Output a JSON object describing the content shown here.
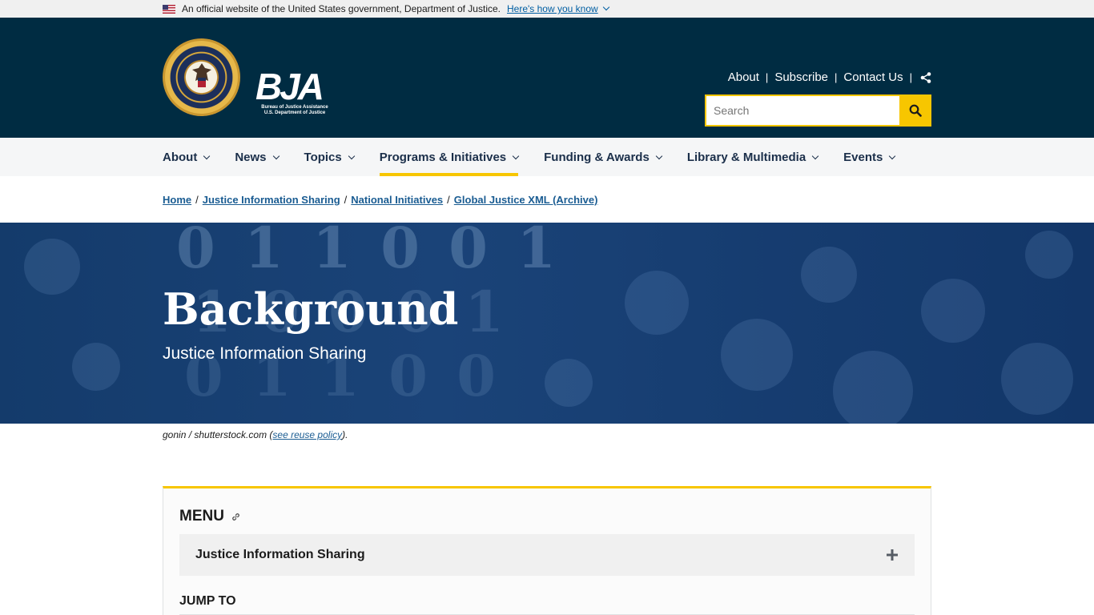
{
  "gov_banner": {
    "text": "An official website of the United States government, Department of Justice.",
    "link": "Here's how you know"
  },
  "header": {
    "logo_letters": "BJA",
    "logo_sub_1": "Bureau of Justice Assistance",
    "logo_sub_2": "U.S. Department of Justice",
    "utility_nav": [
      "About",
      "Subscribe",
      "Contact Us"
    ],
    "search_placeholder": "Search"
  },
  "main_nav": {
    "items": [
      {
        "label": "About",
        "active": false
      },
      {
        "label": "News",
        "active": false
      },
      {
        "label": "Topics",
        "active": false
      },
      {
        "label": "Programs & Initiatives",
        "active": true
      },
      {
        "label": "Funding & Awards",
        "active": false
      },
      {
        "label": "Library & Multimedia",
        "active": false
      },
      {
        "label": "Events",
        "active": false
      }
    ]
  },
  "breadcrumb": [
    "Home",
    "Justice Information Sharing",
    "National Initiatives",
    "Global Justice XML (Archive)"
  ],
  "hero": {
    "title": "Background",
    "subtitle": "Justice Information Sharing"
  },
  "credit": {
    "text": "gonin / shutterstock.com (",
    "link": "see reuse policy",
    "suffix": ")."
  },
  "menu": {
    "heading": "MENU",
    "accordion_label": "Justice Information Sharing",
    "jump_heading": "JUMP TO"
  },
  "colors": {
    "header_bg": "#002c42",
    "accent_yellow": "#f7c600",
    "hero_bg": "#1a4378",
    "link_blue": "#1a5c92"
  }
}
